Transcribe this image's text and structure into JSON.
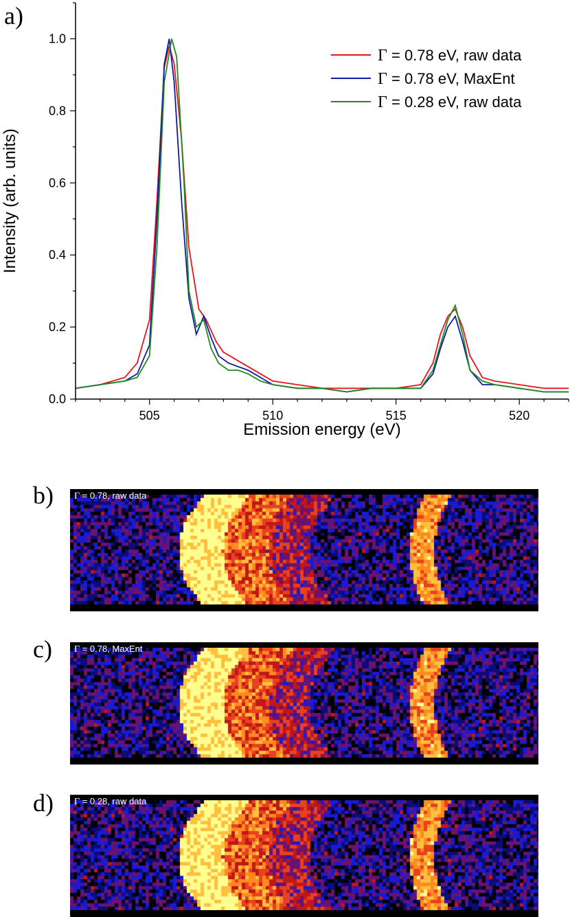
{
  "panel_labels": {
    "a": "a)",
    "b": "b)",
    "c": "c)",
    "d": "d)"
  },
  "chart_data": [
    {
      "type": "line",
      "xlabel": "Emission energy (eV)",
      "ylabel": "Intensity (arb. units)",
      "xlim": [
        502,
        522
      ],
      "ylim": [
        0,
        1.1
      ],
      "xticks": [
        505,
        510,
        515,
        520
      ],
      "yticks": [
        0.0,
        0.2,
        0.4,
        0.6,
        0.8,
        1.0
      ],
      "xtick_labels": [
        "505",
        "510",
        "515",
        "520"
      ],
      "ytick_labels": [
        "0.0",
        "0.2",
        "0.4",
        "0.6",
        "0.8",
        "1.0"
      ],
      "legend_position": "top-right",
      "series": [
        {
          "name": "Γ = 0.78 eV, raw data",
          "legend_symbol": "Γ",
          "legend_text": " = 0.78 eV, raw data",
          "color": "#e8141c",
          "x": [
            502.0,
            503.0,
            504.0,
            504.5,
            505.0,
            505.3,
            505.6,
            505.8,
            506.0,
            506.3,
            506.6,
            507.0,
            507.3,
            507.7,
            508.0,
            508.5,
            509.0,
            509.5,
            510.0,
            511.0,
            512.0,
            513.0,
            514.0,
            515.0,
            516.0,
            516.5,
            516.8,
            517.1,
            517.4,
            517.7,
            518.0,
            518.5,
            519.0,
            520.0,
            521.0,
            522.0
          ],
          "y": [
            0.03,
            0.04,
            0.06,
            0.1,
            0.22,
            0.55,
            0.92,
            0.98,
            0.93,
            0.72,
            0.42,
            0.25,
            0.22,
            0.16,
            0.13,
            0.11,
            0.09,
            0.07,
            0.05,
            0.04,
            0.03,
            0.03,
            0.03,
            0.03,
            0.04,
            0.1,
            0.18,
            0.23,
            0.25,
            0.2,
            0.12,
            0.06,
            0.05,
            0.04,
            0.03,
            0.03
          ]
        },
        {
          "name": "Γ = 0.78 eV, MaxEnt",
          "legend_symbol": "Γ",
          "legend_text": " = 0.78 eV, MaxEnt",
          "color": "#0c1aa0",
          "x": [
            502.0,
            503.0,
            504.0,
            504.5,
            505.0,
            505.3,
            505.6,
            505.8,
            506.0,
            506.3,
            506.6,
            506.9,
            507.2,
            507.5,
            507.8,
            508.2,
            508.6,
            509.0,
            509.5,
            510.0,
            511.0,
            512.0,
            513.0,
            514.0,
            515.0,
            516.0,
            516.5,
            516.8,
            517.1,
            517.4,
            517.7,
            518.0,
            518.5,
            519.0,
            520.0,
            521.0,
            522.0
          ],
          "y": [
            0.03,
            0.04,
            0.05,
            0.07,
            0.15,
            0.5,
            0.93,
            1.0,
            0.88,
            0.55,
            0.28,
            0.18,
            0.23,
            0.17,
            0.12,
            0.1,
            0.09,
            0.08,
            0.06,
            0.04,
            0.03,
            0.03,
            0.02,
            0.03,
            0.03,
            0.03,
            0.07,
            0.14,
            0.2,
            0.23,
            0.16,
            0.08,
            0.04,
            0.04,
            0.03,
            0.02,
            0.02
          ]
        },
        {
          "name": "Γ = 0.28 eV, raw data",
          "legend_symbol": "Γ",
          "legend_text": " = 0.28 eV, raw data",
          "color": "#1f8a1f",
          "x": [
            502.0,
            503.0,
            504.0,
            504.5,
            505.0,
            505.3,
            505.6,
            505.9,
            506.1,
            506.4,
            506.6,
            506.9,
            507.2,
            507.5,
            507.8,
            508.2,
            508.6,
            509.0,
            509.5,
            510.0,
            511.0,
            512.0,
            513.0,
            514.0,
            515.0,
            516.0,
            516.5,
            516.8,
            517.1,
            517.4,
            517.7,
            518.0,
            518.5,
            519.0,
            520.0,
            521.0,
            522.0
          ],
          "y": [
            0.03,
            0.04,
            0.05,
            0.06,
            0.12,
            0.42,
            0.88,
            1.0,
            0.95,
            0.6,
            0.3,
            0.2,
            0.22,
            0.14,
            0.1,
            0.08,
            0.08,
            0.07,
            0.05,
            0.04,
            0.03,
            0.03,
            0.02,
            0.03,
            0.03,
            0.03,
            0.08,
            0.15,
            0.22,
            0.26,
            0.18,
            0.08,
            0.05,
            0.04,
            0.03,
            0.02,
            0.02
          ]
        }
      ]
    },
    {
      "type": "heatmap",
      "caption_symbol": "Γ",
      "caption_text": " = 0.78, raw data",
      "colormap": [
        "#000000",
        "#1010c8",
        "#d01010",
        "#ff9020",
        "#ffff80"
      ]
    },
    {
      "type": "heatmap",
      "caption_symbol": "Γ",
      "caption_text": " = 0.78, MaxEnt",
      "colormap": [
        "#000000",
        "#1010c8",
        "#d01010",
        "#ff9020",
        "#ffff80"
      ]
    },
    {
      "type": "heatmap",
      "caption_symbol": "Γ",
      "caption_text": " = 0.28, raw data",
      "colormap": [
        "#000000",
        "#1010c8",
        "#d01010",
        "#ff9020",
        "#ffff80"
      ]
    }
  ]
}
